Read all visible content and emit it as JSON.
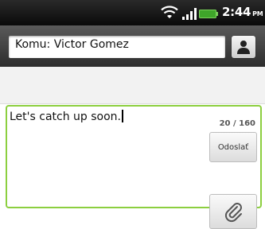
{
  "status_bar": {
    "time": "2:44",
    "ampm": "PM",
    "icons": [
      "wifi-icon",
      "signal-icon",
      "battery-icon"
    ]
  },
  "recipient": {
    "field_text": "Komu: Victor Gomez",
    "contact_icon": "person-icon"
  },
  "compose": {
    "message_text": "Let's catch up soon.",
    "char_count": "20 / 160",
    "send_label": "Odoslať",
    "attach_icon": "paperclip-icon",
    "border_color": "#8ccf3f"
  }
}
